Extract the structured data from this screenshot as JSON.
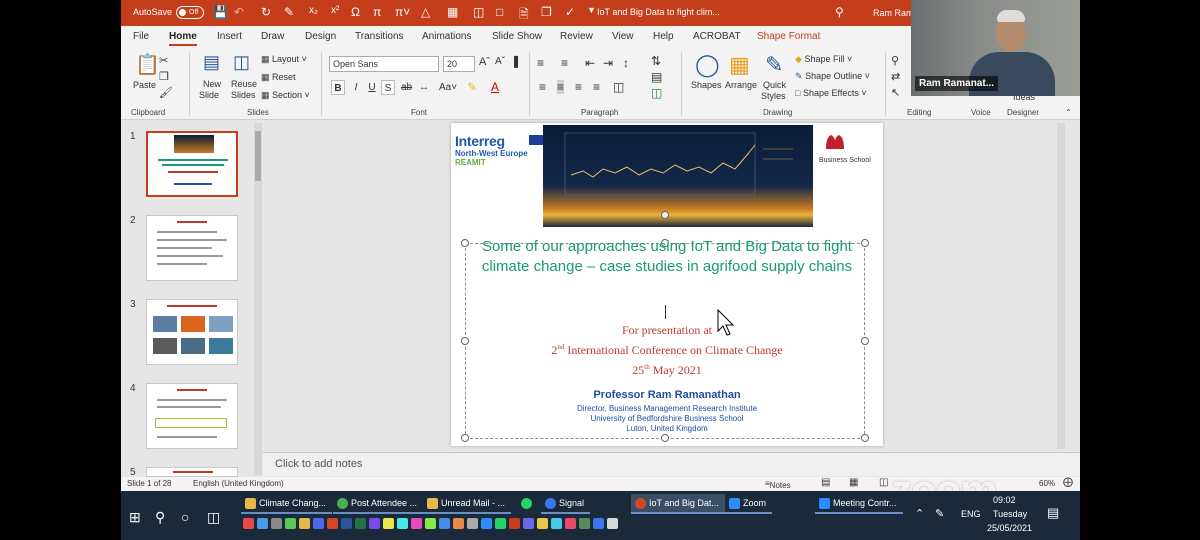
{
  "titlebar": {
    "autosave": "AutoSave",
    "autosave_state": "Off",
    "doc_title": "IoT and Big Data to fight clim...",
    "user": "Ram Rama"
  },
  "tabs": [
    "File",
    "Home",
    "Insert",
    "Draw",
    "Design",
    "Transitions",
    "Animations",
    "Slide Show",
    "Review",
    "View",
    "Help",
    "ACROBAT",
    "Shape Format"
  ],
  "ribbon": {
    "paste": "Paste",
    "clipboard": "Clipboard",
    "new_slide": "New",
    "new_slide2": "Slide",
    "reuse": "Reuse",
    "reuse2": "Slides",
    "layout": "Layout",
    "reset": "Reset",
    "section": "Section",
    "slides": "Slides",
    "font_name": "Open Sans",
    "font_size": "20",
    "font": "Font",
    "paragraph": "Paragraph",
    "shapes": "Shapes",
    "arrange": "Arrange",
    "quick_styles": "Quick",
    "quick_styles2": "Styles",
    "shape_fill": "Shape Fill",
    "shape_outline": "Shape Outline",
    "shape_effects": "Shape Effects",
    "drawing": "Drawing",
    "editing": "Editing",
    "voice": "Voice",
    "designer": "Designer",
    "ideas": "Ideas",
    "bold": "B",
    "italic": "I",
    "underline": "U",
    "shadow": "S"
  },
  "webcam": {
    "name": "Ram Ramanat..."
  },
  "thumbnails": [
    {
      "num": "1"
    },
    {
      "num": "2"
    },
    {
      "num": "3"
    },
    {
      "num": "4"
    },
    {
      "num": "5"
    }
  ],
  "slide": {
    "interreg": "Interreg",
    "nwe": "North-West Europe",
    "reamit": "REAMIT",
    "business_school": "Business School",
    "title": "Some of our approaches using IoT and Big Data to fight climate change – case studies in agrifood supply chains",
    "for_presentation": "For presentation at",
    "conf_num": "2",
    "conf_sup": "nd",
    "conference": " International Conference on Climate Change",
    "date_num": "25",
    "date_sup": "th",
    "date_rest": " May 2021",
    "presenter": "Professor Ram Ramanathan",
    "aff1": "Director, Business Management Research Institute",
    "aff2": "University of Bedfordshire Business School",
    "aff3": "Luton, United Kingdom"
  },
  "notes_placeholder": "Click to add notes",
  "status": {
    "slide_count": "Slide 1 of 28",
    "language": "English (United Kingdom)",
    "notes": "Notes",
    "zoom": "60%"
  },
  "taskbar": {
    "items": [
      {
        "label": "Climate Chang...",
        "color": "#e8b84a"
      },
      {
        "label": "Post Attendee ...",
        "color": "#4caf50"
      },
      {
        "label": "Unread Mail - ...",
        "color": "#e8b84a"
      },
      {
        "label": "Signal",
        "color": "#3a76f0"
      },
      {
        "label": "IoT and Big Dat...",
        "color": "#d24726"
      },
      {
        "label": "Zoom",
        "color": "#2d8cff"
      },
      {
        "label": "Meeting Contr...",
        "color": "#2d8cff"
      }
    ],
    "lang": "ENG",
    "time": "09:02",
    "day": "Tuesday",
    "date": "25/05/2021"
  },
  "zoom_logo": "zoom",
  "colors": {
    "accent": "#c43e1c",
    "title_green": "#1a9a78",
    "red_text": "#c0392b",
    "blue_text": "#1f4fa0"
  }
}
